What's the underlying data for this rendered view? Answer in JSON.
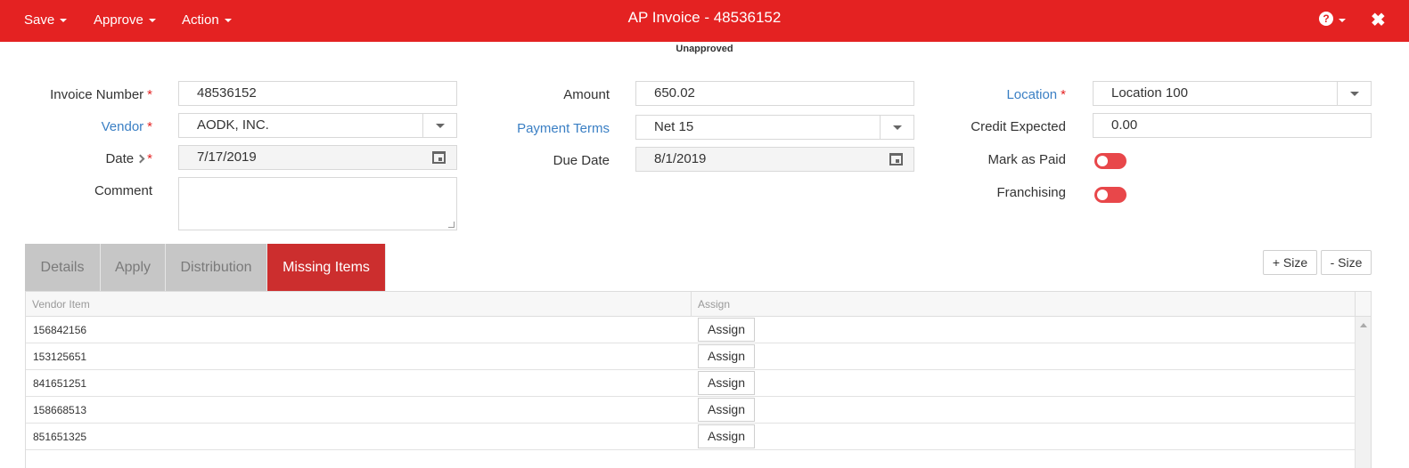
{
  "header": {
    "title": "AP Invoice - 48536152",
    "menus": [
      "Save",
      "Approve",
      "Action"
    ],
    "help_glyph": "?",
    "close_glyph": "✖"
  },
  "status": "Unapproved",
  "form": {
    "invoice_number": {
      "label": "Invoice Number",
      "value": "48536152"
    },
    "vendor": {
      "label": "Vendor",
      "value": "AODK, INC."
    },
    "date": {
      "label": "Date",
      "value": "7/17/2019"
    },
    "comment": {
      "label": "Comment",
      "value": ""
    },
    "amount": {
      "label": "Amount",
      "value": "650.02"
    },
    "payment_terms": {
      "label": "Payment Terms",
      "value": "Net 15"
    },
    "due_date": {
      "label": "Due Date",
      "value": "8/1/2019"
    },
    "location": {
      "label": "Location",
      "value": "Location 100"
    },
    "credit_expected": {
      "label": "Credit Expected",
      "value": "0.00"
    },
    "mark_as_paid": {
      "label": "Mark as Paid",
      "on": false
    },
    "franchising": {
      "label": "Franchising",
      "on": false
    },
    "required_marker": "*"
  },
  "tabs": [
    {
      "label": "Details",
      "active": false
    },
    {
      "label": "Apply",
      "active": false
    },
    {
      "label": "Distribution",
      "active": false
    },
    {
      "label": "Missing Items",
      "active": true
    }
  ],
  "size_buttons": {
    "increase": "+ Size",
    "decrease": "- Size"
  },
  "grid": {
    "columns": [
      "Vendor Item",
      "Assign"
    ],
    "assign_label": "Assign",
    "rows": [
      "156842156",
      "153125651",
      "841651251",
      "158668513",
      "851651325"
    ]
  },
  "colors": {
    "brand": "#e42222",
    "active_tab": "#cc2e2e",
    "link": "#3a7fc4",
    "toggle": "#e8474a"
  }
}
